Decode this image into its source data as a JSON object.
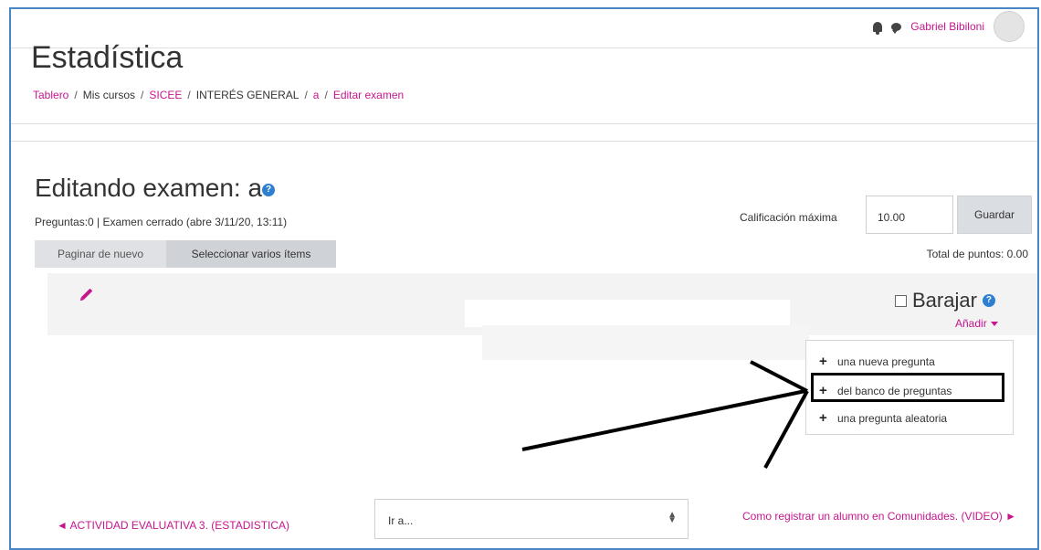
{
  "top_caption": "",
  "user": {
    "name": "Gabriel Bibiloni"
  },
  "course": {
    "title": "Estadística"
  },
  "breadcrumb": [
    {
      "label": "Tablero",
      "link": true
    },
    {
      "label": "Mis cursos",
      "link": false
    },
    {
      "label": "SICEE",
      "link": true
    },
    {
      "label": "INTERÉS GENERAL",
      "link": false
    },
    {
      "label": "a",
      "link": true
    },
    {
      "label": "Editar examen",
      "link": true
    }
  ],
  "page": {
    "title": "Editando examen: a",
    "quiz_info": "Preguntas:0 | Examen cerrado (abre 3/11/20, 13:11)",
    "repaginate_label": "Paginar de nuevo",
    "select_multiple_label": "Seleccionar varios ítems",
    "max_grade_label": "Calificación máxima",
    "max_grade_value": "10.00",
    "save_label": "Guardar",
    "total_points": "Total de puntos: 0.00"
  },
  "section": {
    "shuffle_label": "Barajar",
    "shuffle_checked": false,
    "add_label": "Añadir"
  },
  "add_menu": {
    "items": [
      {
        "label": "una nueva pregunta"
      },
      {
        "label": "del banco de preguntas"
      },
      {
        "label": "una pregunta aleatoria"
      }
    ]
  },
  "footer": {
    "prev_activity": "◄ ACTIVIDAD EVALUATIVA 3. (ESTADISTICA)",
    "jump_placeholder": "Ir a...",
    "next_activity": "Como registrar un alumno en Comunidades. (VIDEO) ►"
  },
  "colors": {
    "link": "#c6168d",
    "help": "#2f7fd1",
    "frame": "#4a86c5"
  }
}
